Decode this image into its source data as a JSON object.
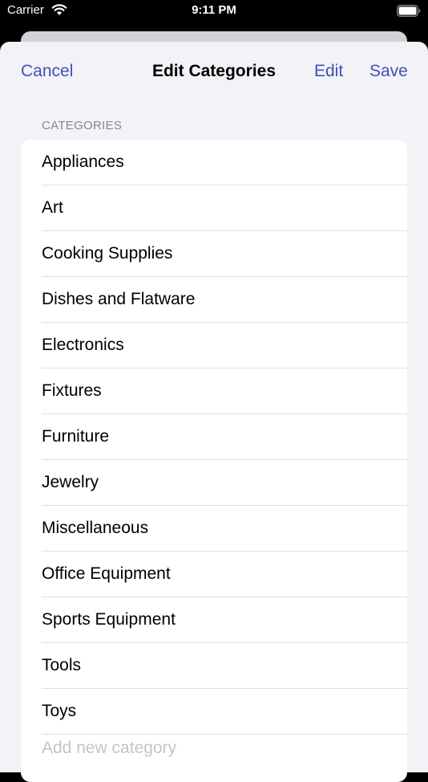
{
  "status_bar": {
    "carrier": "Carrier",
    "time": "9:11 PM",
    "wifi_icon": "wifi-icon",
    "battery_icon": "battery-icon"
  },
  "nav": {
    "cancel": "Cancel",
    "title": "Edit Categories",
    "edit": "Edit",
    "save": "Save"
  },
  "section_header": "CATEGORIES",
  "categories": [
    "Appliances",
    "Art",
    "Cooking Supplies",
    "Dishes and Flatware",
    "Electronics",
    "Fixtures",
    "Furniture",
    "Jewelry",
    "Miscellaneous",
    "Office Equipment",
    "Sports Equipment",
    "Tools",
    "Toys"
  ],
  "add_field": {
    "placeholder": "Add new category",
    "value": ""
  },
  "colors": {
    "accent": "#3f51b5",
    "background": "#f2f2f7",
    "card": "#ffffff",
    "secondary_text": "#86868b"
  }
}
